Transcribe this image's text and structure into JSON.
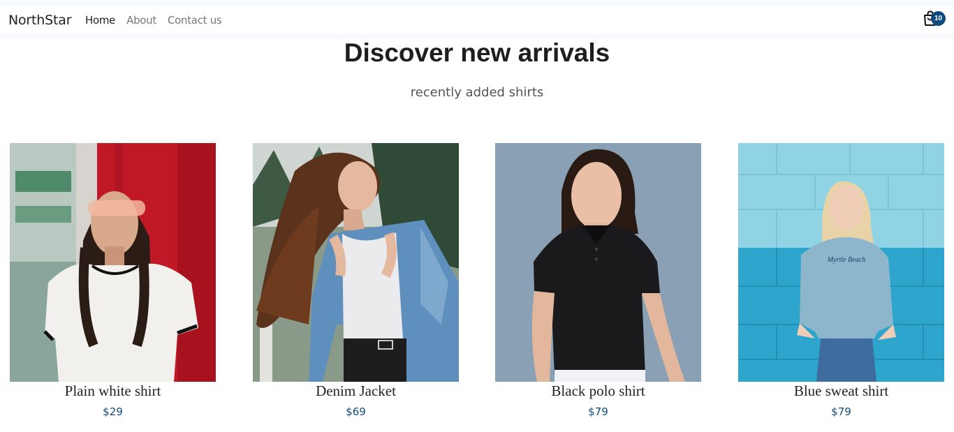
{
  "navbar": {
    "brand": "NorthStar",
    "links": [
      {
        "label": "Home",
        "active": true
      },
      {
        "label": "About",
        "active": false
      },
      {
        "label": "Contact us",
        "active": false
      }
    ],
    "cart": {
      "icon": "shopping-bag-icon",
      "count": "10",
      "badge_color": "#0d4a7d"
    }
  },
  "hero": {
    "title": "Discover new arrivals",
    "subtitle": "recently added shirts"
  },
  "products": [
    {
      "name": "Plain white shirt",
      "price": "$29"
    },
    {
      "name": "Denim Jacket",
      "price": "$69"
    },
    {
      "name": "Black polo shirt",
      "price": "$79"
    },
    {
      "name": "Blue sweat shirt",
      "price": "$79"
    }
  ],
  "colors": {
    "accent": "#0d4a7d",
    "text": "#222222",
    "muted": "#777777"
  }
}
